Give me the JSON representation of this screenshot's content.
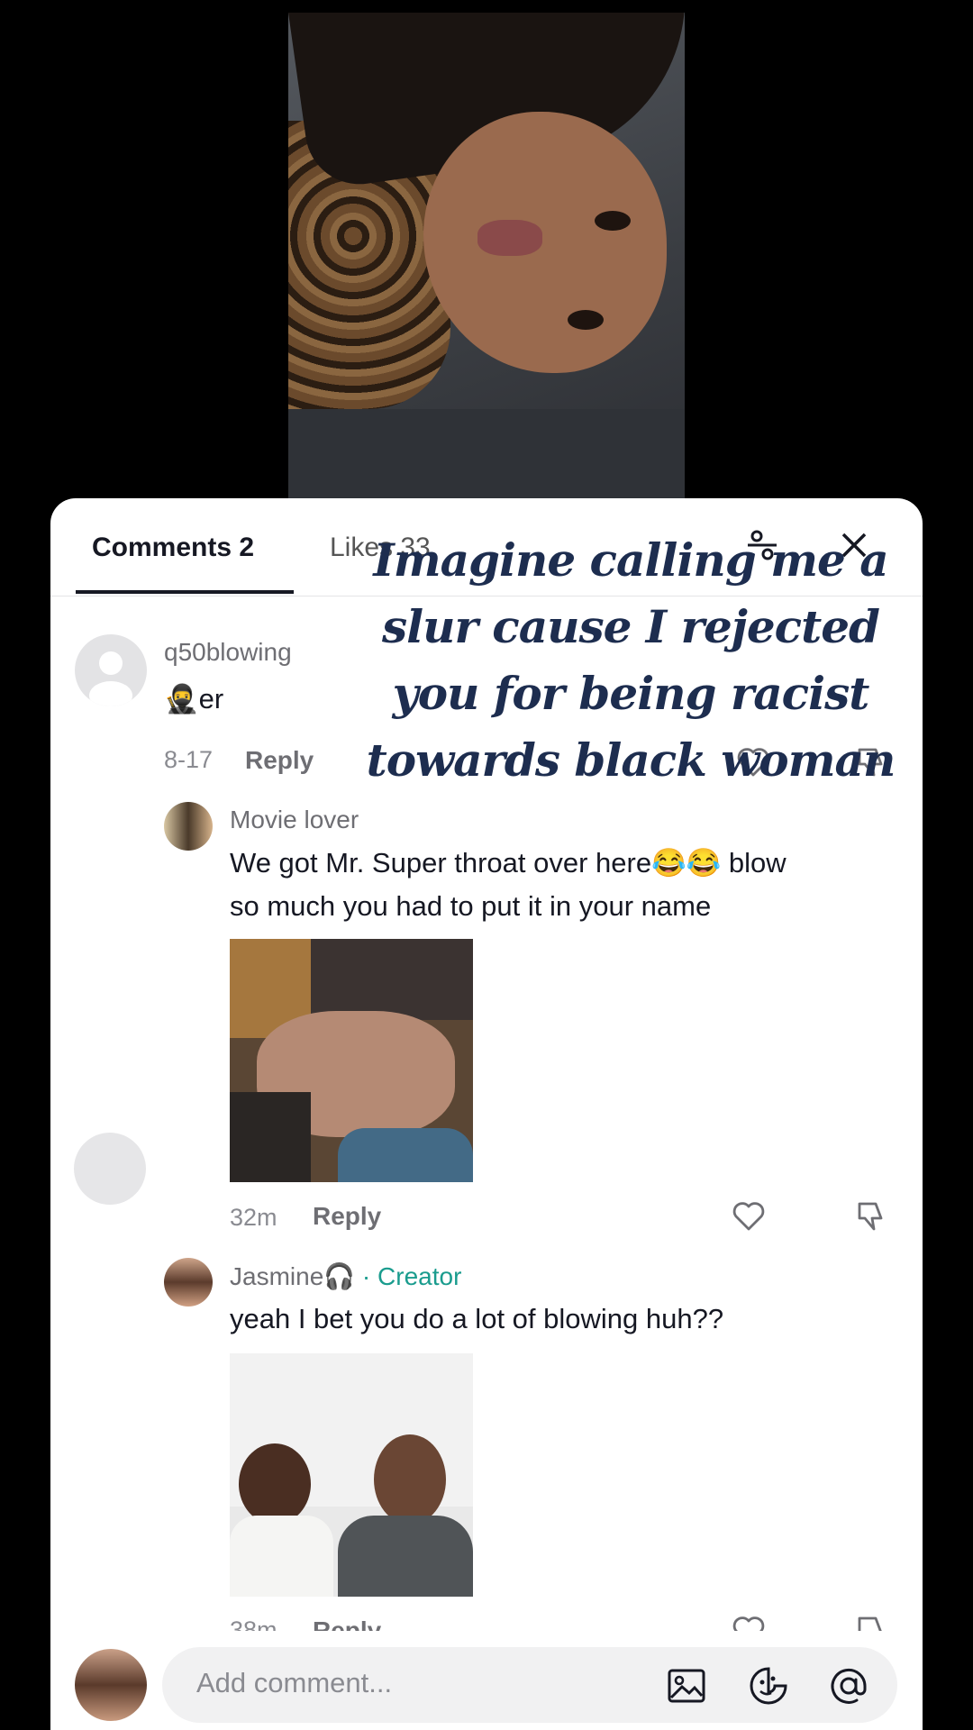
{
  "tabs": {
    "comments_label": "Comments 2",
    "likes_label": "Likes 33"
  },
  "overlay_caption": {
    "lines": [
      "Imagine calling me a",
      "slur cause I rejected",
      "you for being racist",
      "towards black woman"
    ]
  },
  "comments": [
    {
      "username": "q50blowing",
      "text": "er",
      "emoji": "🥷",
      "time": "8-17",
      "reply_label": "Reply"
    },
    {
      "username": "Movie lover",
      "text_line1": "We got Mr. Super throat over here😂😂 blow",
      "text_line2": "so much you had to put it in your name",
      "time": "32m",
      "reply_label": "Reply"
    },
    {
      "username": "Jasmine",
      "badge": "🎧",
      "creator_label": "· Creator",
      "text": "yeah I bet you do a lot of blowing huh??",
      "time": "38m",
      "reply_label": "Reply"
    }
  ],
  "composer": {
    "placeholder": "Add comment..."
  },
  "icons": {
    "filter": "slider-icon",
    "close": "close-icon",
    "like": "heart-icon",
    "dislike": "thumbs-down-icon",
    "image": "image-icon",
    "sticker": "emoji-sticker-icon",
    "mention": "at-icon"
  },
  "colors": {
    "creator": "#1a9c8e",
    "overlay_text": "#1d2d4f"
  }
}
